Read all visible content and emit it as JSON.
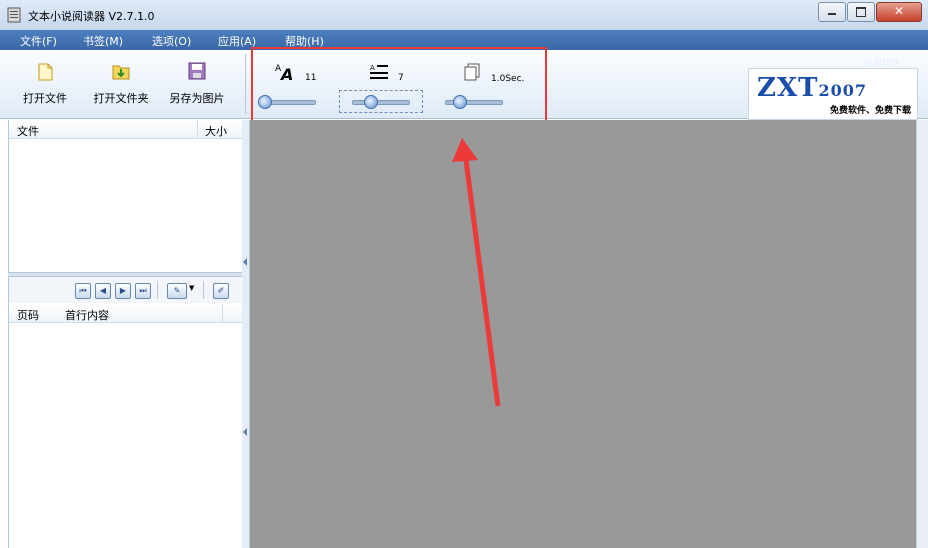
{
  "window": {
    "title": "文本小说阅读器 V2.7.1.0"
  },
  "menu": [
    "文件(F)",
    "书签(M)",
    "选项(O)",
    "应用(A)",
    "帮助(H)"
  ],
  "toolbar": {
    "open_file": "打开文件",
    "open_folder": "打开文件夹",
    "save_as_image": "另存为图片"
  },
  "controls": {
    "font_size": "11",
    "line_spacing": "7",
    "page_interval": "1.0Sec."
  },
  "logo": {
    "brand": "ZXT",
    "year": "2007",
    "tagline": "免费软件、免费下载",
    "header_tag": "应用软件"
  },
  "file_list": {
    "col_file": "文件",
    "col_size": "大小"
  },
  "bookmark_list": {
    "col_page": "页码",
    "col_first_line": "首行内容"
  },
  "colors": {
    "menubar": "#3a67a6",
    "content_bg": "#999999",
    "highlight": "#e8393b"
  }
}
